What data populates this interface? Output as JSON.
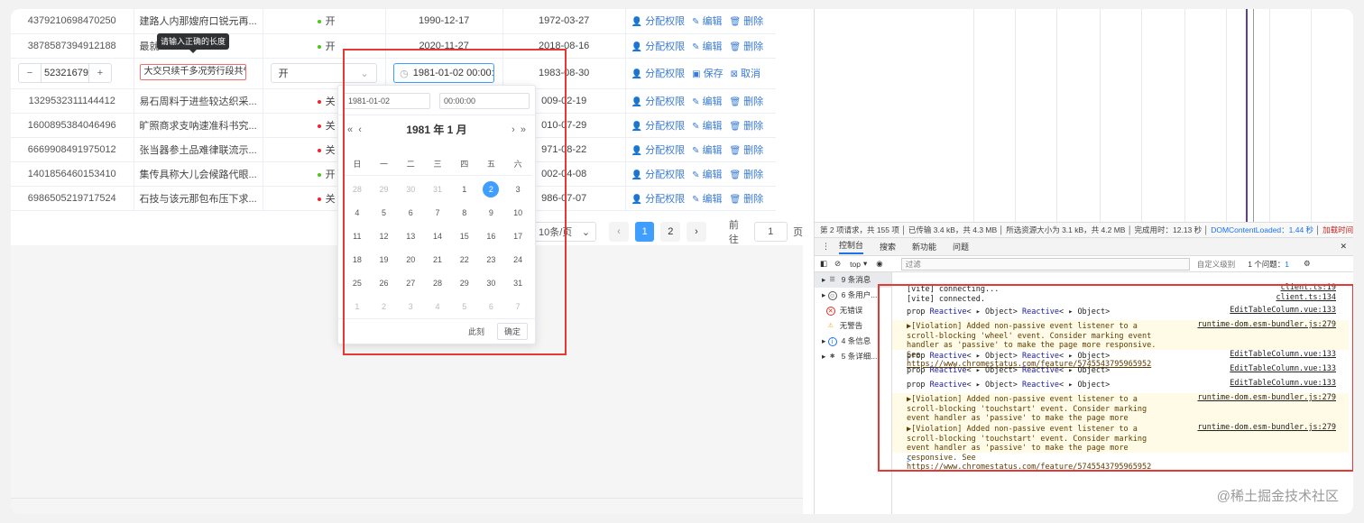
{
  "table": {
    "rows_top": [
      {
        "id": "4379210698470250",
        "name": "建路人内那嫂府口锐元再...",
        "status": "开",
        "status_on": true,
        "date1": "1990-12-17",
        "date2": "1972-03-27"
      },
      {
        "id": "3878587394912188",
        "name": "最就",
        "status": "开",
        "status_on": true,
        "date1": "2020-11-27",
        "date2": "2018-08-16"
      }
    ],
    "edit_row": {
      "minus": "−",
      "plus": "+",
      "id_value": "52321679:",
      "name_value": "大交只续千多况劳行段共气经.",
      "status_value": "开",
      "datetime_value": "1981-01-02 00:00:",
      "date2": "1983-08-30"
    },
    "rows_bottom": [
      {
        "id": "1329532311144412",
        "name": "易石周料于进些较达织采...",
        "status": "关",
        "status_on": false,
        "date2": "009-02-19"
      },
      {
        "id": "1600895384046496",
        "name": "旷照商求支呐速准科书究...",
        "status": "关",
        "status_on": false,
        "date2": "010-07-29"
      },
      {
        "id": "6669908491975012",
        "name": "张当器参土品难律联流示...",
        "status": "关",
        "status_on": false,
        "date2": "971-08-22"
      },
      {
        "id": "1401856460153410",
        "name": "集传具称大儿会候路代眼...",
        "status": "开",
        "status_on": true,
        "date2": "002-04-08"
      },
      {
        "id": "6986505219717524",
        "name": "石技与该元那包布压下求...",
        "status": "关",
        "status_on": false,
        "date2": "986-07-07"
      }
    ],
    "ops": {
      "assign": "分配权限",
      "edit": "编辑",
      "delete": "删除",
      "save": "保存",
      "cancel": "取消"
    }
  },
  "tooltip": "请输入正确的长度",
  "pagination": {
    "page_size": "10条/页",
    "pages": [
      "1",
      "2"
    ],
    "current": "1",
    "goto_label": "前往",
    "goto_value": "1",
    "page_suffix": "页"
  },
  "picker": {
    "date_input": "1981-01-02",
    "time_input": "00:00:00",
    "title": "1981 年 1 月",
    "weekdays": [
      "日",
      "一",
      "二",
      "三",
      "四",
      "五",
      "六"
    ],
    "days": [
      {
        "d": "28",
        "m": 1
      },
      {
        "d": "29",
        "m": 1
      },
      {
        "d": "30",
        "m": 1
      },
      {
        "d": "31",
        "m": 1
      },
      {
        "d": "1",
        "m": 0
      },
      {
        "d": "2",
        "m": 2
      },
      {
        "d": "3",
        "m": 0
      },
      {
        "d": "4",
        "m": 0
      },
      {
        "d": "5",
        "m": 0
      },
      {
        "d": "6",
        "m": 0
      },
      {
        "d": "7",
        "m": 0
      },
      {
        "d": "8",
        "m": 0
      },
      {
        "d": "9",
        "m": 0
      },
      {
        "d": "10",
        "m": 0
      },
      {
        "d": "11",
        "m": 0
      },
      {
        "d": "12",
        "m": 0
      },
      {
        "d": "13",
        "m": 0
      },
      {
        "d": "14",
        "m": 0
      },
      {
        "d": "15",
        "m": 0
      },
      {
        "d": "16",
        "m": 0
      },
      {
        "d": "17",
        "m": 0
      },
      {
        "d": "18",
        "m": 0
      },
      {
        "d": "19",
        "m": 0
      },
      {
        "d": "20",
        "m": 0
      },
      {
        "d": "21",
        "m": 0
      },
      {
        "d": "22",
        "m": 0
      },
      {
        "d": "23",
        "m": 0
      },
      {
        "d": "24",
        "m": 0
      },
      {
        "d": "25",
        "m": 0
      },
      {
        "d": "26",
        "m": 0
      },
      {
        "d": "27",
        "m": 0
      },
      {
        "d": "28",
        "m": 0
      },
      {
        "d": "29",
        "m": 0
      },
      {
        "d": "30",
        "m": 0
      },
      {
        "d": "31",
        "m": 0
      },
      {
        "d": "1",
        "m": 1
      },
      {
        "d": "2",
        "m": 1
      },
      {
        "d": "3",
        "m": 1
      },
      {
        "d": "4",
        "m": 1
      },
      {
        "d": "5",
        "m": 1
      },
      {
        "d": "6",
        "m": 1
      },
      {
        "d": "7",
        "m": 1
      }
    ],
    "now_label": "此刻",
    "ok_label": "确定"
  },
  "devtools": {
    "status": {
      "requests": "第 2 项请求，共 155 项",
      "transferred": "已传输 3.4 kB，共 4.3 MB",
      "resources": "所选资源大小为 3.1 kB，共 4.2 MB",
      "finish": "完成用时：12.13 秒",
      "dcl": "DOMContentLoaded：1.44 秒",
      "load": "加载时间"
    },
    "tabs": [
      "控制台",
      "搜索",
      "新功能",
      "问题"
    ],
    "toolbar": {
      "context": "top",
      "filter": "过滤",
      "levels": "自定义级别",
      "issues": "1 个问题：",
      "issues_count": "1"
    },
    "sidebar": [
      "9 条消息",
      "6 条用户...",
      "无错误",
      "无警告",
      "4 条信息",
      "5 条详细..."
    ],
    "console": [
      {
        "text": "[vite] connecting...",
        "src": "client.ts:19"
      },
      {
        "text": "[vite] connected.",
        "src": "client.ts:134"
      },
      {
        "type": "prop",
        "src": "EditTableColumn.vue:133"
      },
      {
        "type": "warn",
        "text": "▶[Violation] Added non-passive event listener to a scroll-blocking 'wheel' event. Consider marking event handler as 'passive' to make the page more responsive. See ",
        "link": "https://www.chromestatus.com/feature/5745543795965952",
        "src": "runtime-dom.esm-bundler.js:279"
      },
      {
        "type": "prop",
        "src": "EditTableColumn.vue:133"
      },
      {
        "type": "prop",
        "src": "EditTableColumn.vue:133"
      },
      {
        "type": "prop",
        "src": "EditTableColumn.vue:133"
      },
      {
        "type": "warn",
        "text": "▶[Violation] Added non-passive event listener to a scroll-blocking 'touchstart' event. Consider marking event handler as 'passive' to make the page more responsive. See ",
        "link": "https://www.chromestatus.com/feature/5745543795965952",
        "src": "runtime-dom.esm-bundler.js:279"
      },
      {
        "type": "warn",
        "text": "▶[Violation] Added non-passive event listener to a scroll-blocking 'touchstart' event. Consider marking event handler as 'passive' to make the page more responsive. See ",
        "link": "https://www.chromestatus.com/feature/5745543795965952",
        "src": "runtime-dom.esm-bundler.js:279"
      }
    ],
    "prop_text": {
      "p": "prop",
      "r": "Reactive",
      "o": "Object"
    },
    "prompt": ">"
  },
  "watermark": "@稀土掘金技术社区",
  "colors": {
    "accent": "#409eff",
    "highlight": "#e53935"
  }
}
